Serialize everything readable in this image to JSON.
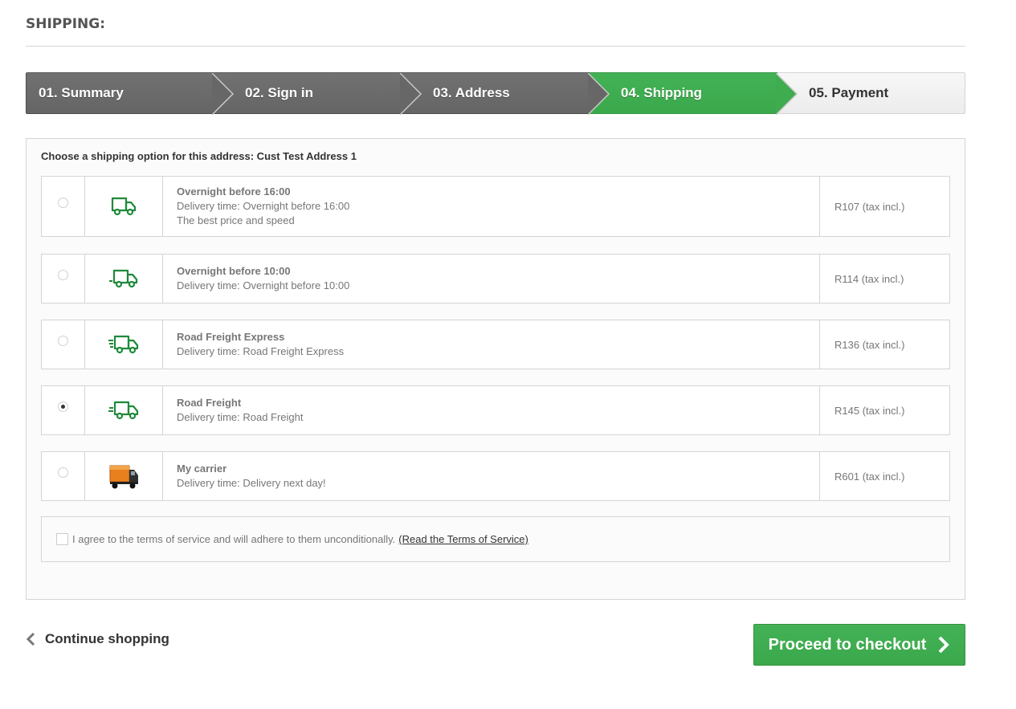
{
  "page": {
    "heading": "SHIPPING:"
  },
  "steps": [
    {
      "label": "01. Summary",
      "state": "done"
    },
    {
      "label": "02. Sign in",
      "state": "done"
    },
    {
      "label": "03. Address",
      "state": "done"
    },
    {
      "label": "04. Shipping",
      "state": "current"
    },
    {
      "label": "05. Payment",
      "state": "todo"
    }
  ],
  "address": {
    "title": "Choose a shipping option for this address: Cust Test Address 1"
  },
  "options": [
    {
      "name": "Overnight before 16:00",
      "delivery": "Delivery time: Overnight before 16:00",
      "extra": "The best price and speed",
      "price": "R107 (tax incl.)",
      "icon": "delivery-truck-icon",
      "selected": false
    },
    {
      "name": "Overnight before 10:00",
      "delivery": "Delivery time: Overnight before 10:00",
      "extra": "",
      "price": "R114 (tax incl.)",
      "icon": "moving-truck-icon",
      "selected": false
    },
    {
      "name": "Road Freight Express",
      "delivery": "Delivery time: Road Freight Express",
      "extra": "",
      "price": "R136 (tax incl.)",
      "icon": "fast-truck-icon",
      "selected": false
    },
    {
      "name": "Road Freight",
      "delivery": "Delivery time: Road Freight",
      "extra": "",
      "price": "R145 (tax incl.)",
      "icon": "fast-truck-icon",
      "selected": true
    },
    {
      "name": "My carrier",
      "delivery": "Delivery time: Delivery next day!",
      "extra": "",
      "price": "R601 (tax incl.)",
      "icon": "carrier-truck-image",
      "selected": false
    }
  ],
  "terms": {
    "text": "I agree to the terms of service and will adhere to them unconditionally.",
    "link": "(Read the Terms of Service)",
    "checked": false
  },
  "actions": {
    "continue": "Continue shopping",
    "checkout": "Proceed to checkout"
  },
  "colors": {
    "accent": "#3aa84b",
    "step_done": "#6b6a6a",
    "icon_green": "#1e8a3a"
  }
}
